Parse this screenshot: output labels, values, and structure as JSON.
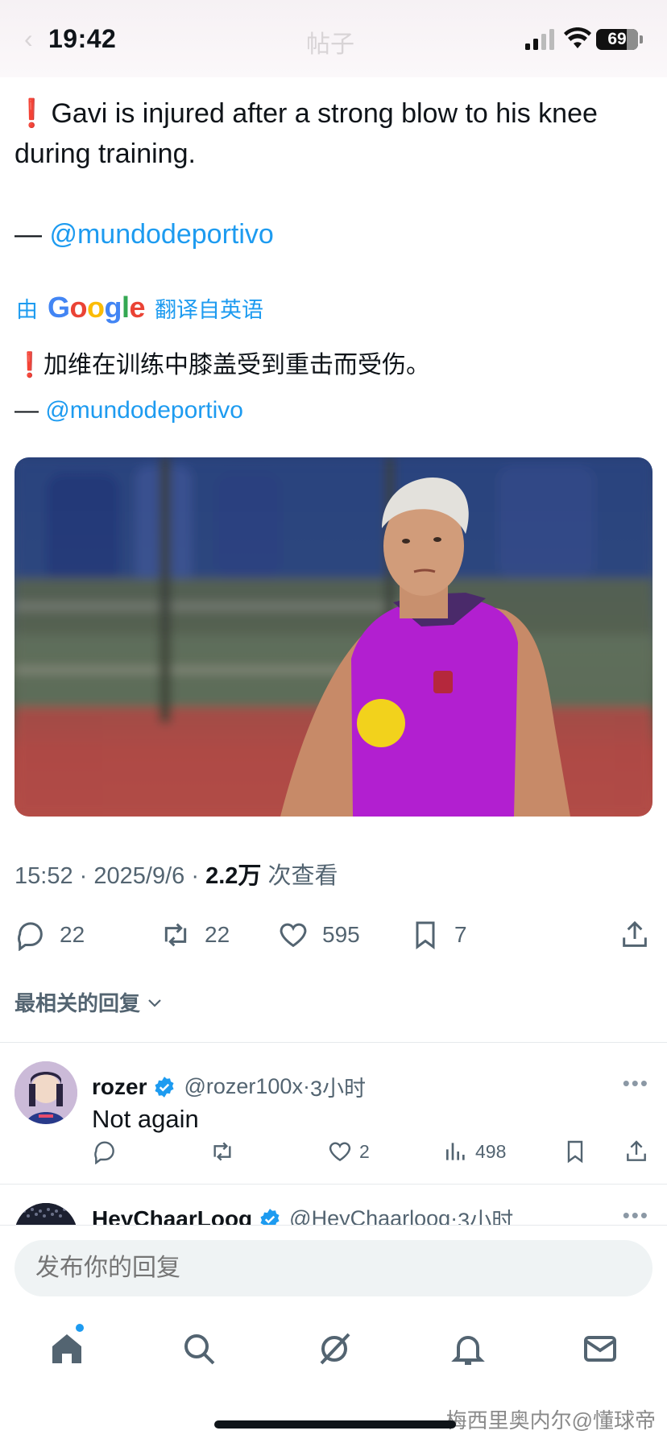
{
  "status_bar": {
    "time": "19:42",
    "battery": "69",
    "background_title": "帖子",
    "back_glyph": "‹"
  },
  "tweet": {
    "exclamation": "❗",
    "text": "Gavi is injured after a strong blow to his knee during training.",
    "attribution_dash": "—",
    "mention": "@mundodeportivo",
    "translation_prefix": "由",
    "translation_brand": "Google",
    "translation_suffix": "翻译自英语",
    "translated_text": "加维在训练中膝盖受到重击而受伤。",
    "image_alt": "Gavi in purple training vest at training ground",
    "time": "15:52",
    "separator": "·",
    "date": "2025/9/6",
    "views_count": "2.2万",
    "views_label": "次查看",
    "stats": {
      "replies": "22",
      "retweets": "22",
      "likes": "595",
      "bookmarks": "7"
    }
  },
  "replies_sort": {
    "label": "最相关的回复"
  },
  "replies": [
    {
      "name": "rozer",
      "handle": "@rozer100x",
      "time": "3小时",
      "text": "Not again",
      "likes": "2",
      "views": "498"
    },
    {
      "name": "HeyChaarLoog",
      "handle": "@HeyChaarloog",
      "time": "3小时"
    }
  ],
  "composer": {
    "placeholder": "发布你的回复"
  },
  "watermark": "梅西里奥内尔@懂球帝",
  "colors": {
    "accent": "#1d9bf0",
    "secondary_text": "#536471",
    "primary_text": "#0f1419",
    "divider": "#e6e9ec"
  }
}
